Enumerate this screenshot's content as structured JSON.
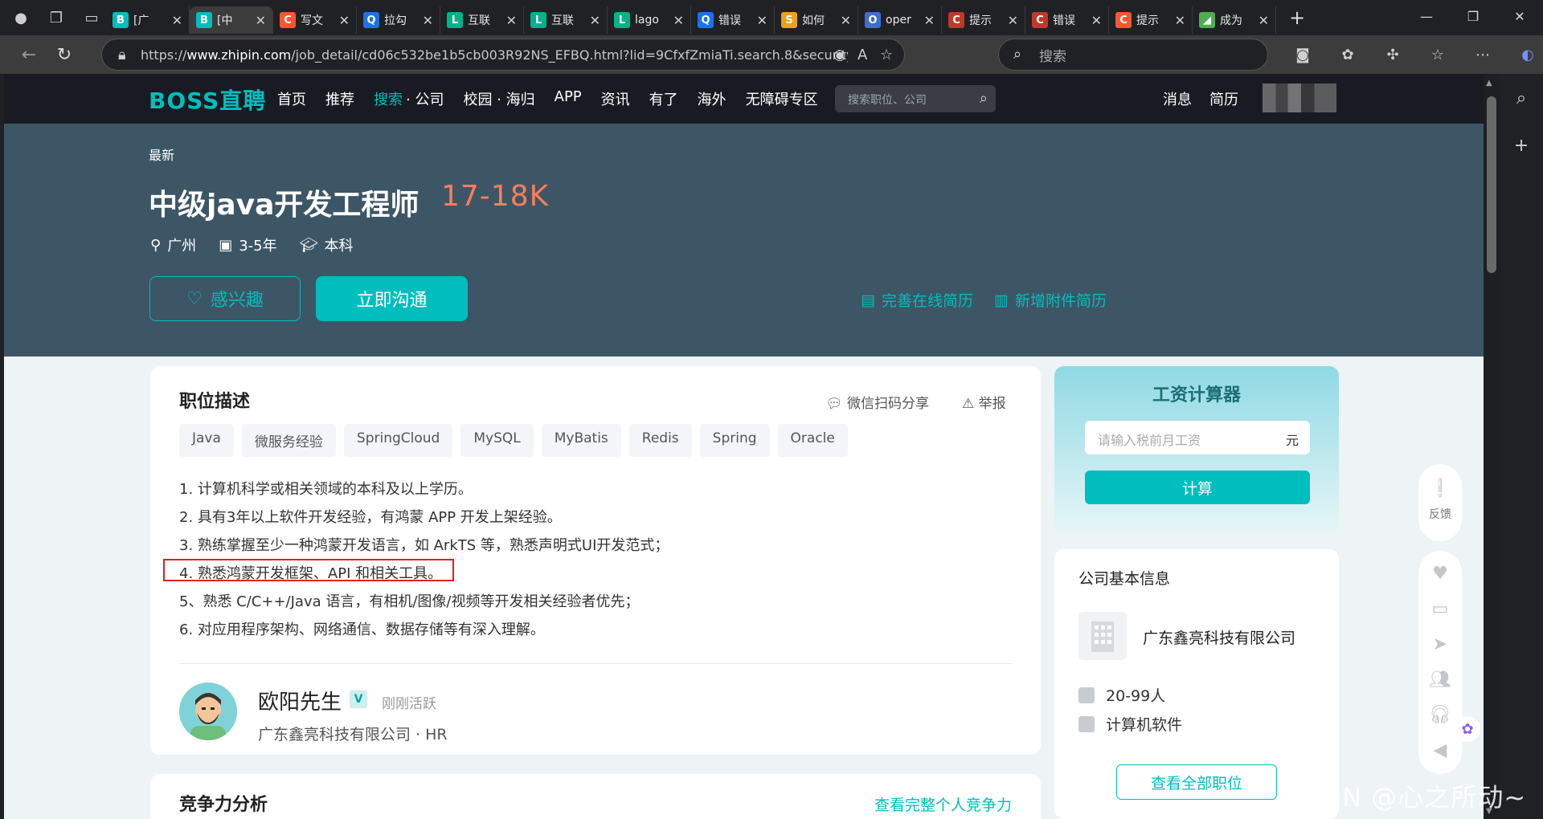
{
  "browser": {
    "tabs": [
      {
        "label": "[广",
        "fav": "B",
        "color": "#00bebd"
      },
      {
        "label": "[中",
        "fav": "B",
        "color": "#00bebd",
        "active": true
      },
      {
        "label": "写文",
        "fav": "C",
        "color": "#fc5531"
      },
      {
        "label": "拉勾",
        "fav": "Q",
        "color": "#1a73e8"
      },
      {
        "label": "互联",
        "fav": "L",
        "color": "#00b38a"
      },
      {
        "label": "互联",
        "fav": "L",
        "color": "#00b38a"
      },
      {
        "label": "lago",
        "fav": "L",
        "color": "#00b38a"
      },
      {
        "label": "错误",
        "fav": "Q",
        "color": "#1a73e8"
      },
      {
        "label": "如何",
        "fav": "S",
        "color": "#e8a21c"
      },
      {
        "label": "oper",
        "fav": "O",
        "color": "#3b6fd4"
      },
      {
        "label": "提示",
        "fav": "C",
        "color": "#c0392b"
      },
      {
        "label": "错误",
        "fav": "C",
        "color": "#c0392b"
      },
      {
        "label": "提示",
        "fav": "C",
        "color": "#fc5531"
      },
      {
        "label": "成为",
        "fav": "◢",
        "color": "#4caf50"
      }
    ],
    "url_prefix": "https://",
    "url_host": "www.zhipin.com",
    "url_path": "/job_detail/cd06c532be1b5cb003R92NS_EFBQ.html?lid=9CfxfZmiaTi.search.8&securityId...",
    "search_placeholder": "搜索"
  },
  "site": {
    "logo": "BOSS直聘",
    "nav": [
      "首页",
      "推荐",
      "搜索",
      "· 公司",
      "校园 · 海归",
      "APP",
      "资讯",
      "有了",
      "海外",
      "无障碍专区"
    ],
    "nav_search_placeholder": "搜索职位、公司",
    "user_links": [
      "消息",
      "简历"
    ]
  },
  "job": {
    "tag": "最新",
    "title": "中级java开发工程师",
    "salary": "17-18K",
    "city": "广州",
    "experience": "3-5年",
    "degree": "本科",
    "interest_btn": "感兴趣",
    "chat_btn": "立即沟通",
    "resume_link_1": "完善在线简历",
    "resume_link_2": "新增附件简历"
  },
  "description": {
    "heading": "职位描述",
    "share": "微信扫码分享",
    "report": "举报",
    "skills": [
      "Java",
      "微服务经验",
      "SpringCloud",
      "MySQL",
      "MyBatis",
      "Redis",
      "Spring",
      "Oracle"
    ],
    "requirements": [
      "1. 计算机科学或相关领域的本科及以上学历。",
      "2. 具有3年以上软件开发经验，有鸿蒙 APP 开发上架经验。",
      "3. 熟练掌握至少一种鸿蒙开发语言，如 ArkTS 等，熟悉声明式UI开发范式；",
      "4. 熟悉鸿蒙开发框架、API 和相关工具。",
      "5、熟悉 C/C++/Java 语言，有相机/图像/视频等开发相关经验者优先；",
      "6. 对应用程序架构、网络通信、数据存储等有深入理解。"
    ],
    "hr_name": "欧阳先生",
    "hr_badge": "V",
    "hr_status": "刚刚活跃",
    "hr_company": "广东鑫亮科技有限公司 ·  HR"
  },
  "competitiveness": {
    "heading": "竞争力分析",
    "link": "查看完整个人竞争力"
  },
  "calculator": {
    "title": "工资计算器",
    "placeholder": "请输入税前月工资",
    "unit": "元",
    "button": "计算"
  },
  "company": {
    "heading": "公司基本信息",
    "name": "广东鑫亮科技有限公司",
    "size": "20-99人",
    "industry": "计算机软件",
    "all_jobs_btn": "查看全部职位"
  },
  "side": {
    "feedback": "反馈"
  },
  "watermark": "CSDN @心之所动~"
}
